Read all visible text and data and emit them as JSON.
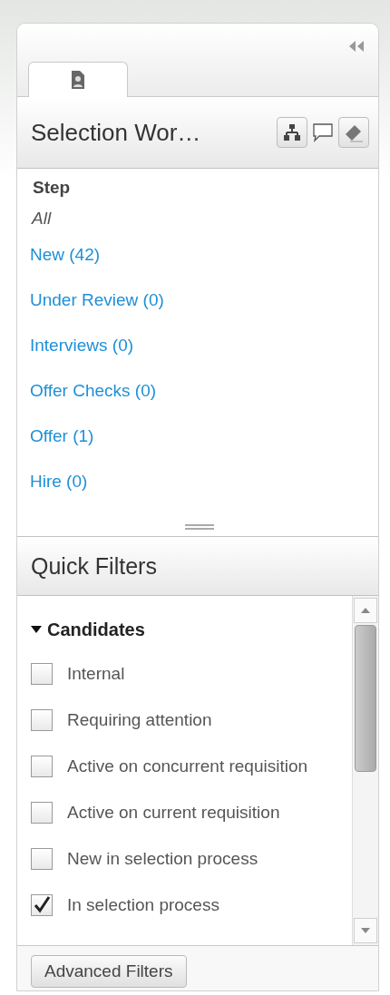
{
  "tabs": [
    {
      "kind": "person",
      "selected": true
    }
  ],
  "header": {
    "title": "Selection Wor…"
  },
  "steps": {
    "heading": "Step",
    "items": [
      {
        "label": "All",
        "selected": true
      },
      {
        "label": "New (42)",
        "selected": false
      },
      {
        "label": "Under Review (0)",
        "selected": false
      },
      {
        "label": "Interviews (0)",
        "selected": false
      },
      {
        "label": "Offer Checks (0)",
        "selected": false
      },
      {
        "label": "Offer (1)",
        "selected": false
      },
      {
        "label": "Hire (0)",
        "selected": false
      }
    ]
  },
  "quick_filters": {
    "title": "Quick Filters",
    "group": {
      "label": "Candidates",
      "expanded": true
    },
    "items": [
      {
        "label": "Internal",
        "checked": false
      },
      {
        "label": "Requiring attention",
        "checked": false
      },
      {
        "label": "Active on concurrent requisition",
        "checked": false
      },
      {
        "label": "Active on current requisition",
        "checked": false
      },
      {
        "label": "New in selection process",
        "checked": false
      },
      {
        "label": "In selection process",
        "checked": true
      }
    ]
  },
  "buttons": [
    "Advanced Filters"
  ]
}
